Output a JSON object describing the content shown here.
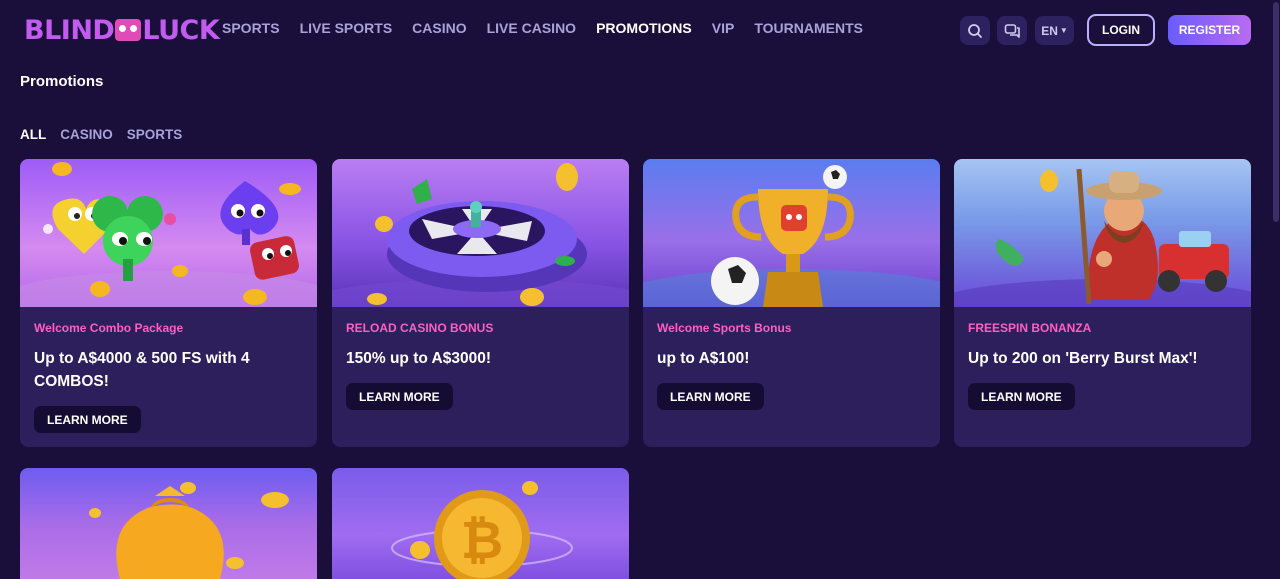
{
  "brand": {
    "logo_left": "BLIND",
    "logo_right": "LUCK"
  },
  "nav": [
    {
      "label": "SPORTS"
    },
    {
      "label": "LIVE SPORTS"
    },
    {
      "label": "CASINO"
    },
    {
      "label": "LIVE CASINO"
    },
    {
      "label": "PROMOTIONS",
      "active": true
    },
    {
      "label": "VIP"
    },
    {
      "label": "TOURNAMENTS"
    }
  ],
  "header": {
    "search_icon": "search-icon",
    "chat_icon": "chat-icon",
    "language": "EN",
    "login_label": "LOGIN",
    "register_label": "REGISTER"
  },
  "page": {
    "title": "Promotions"
  },
  "filters": [
    {
      "label": "ALL",
      "active": true
    },
    {
      "label": "CASINO"
    },
    {
      "label": "SPORTS"
    }
  ],
  "promos": [
    {
      "tag": "Welcome Combo Package",
      "title": "Up to A$4000 & 500 FS with 4 COMBOS!",
      "button": "LEARN MORE"
    },
    {
      "tag": "RELOAD CASINO BONUS",
      "title": "150% up to A$3000!",
      "button": "LEARN MORE"
    },
    {
      "tag": "Welcome Sports Bonus",
      "title": "up to A$100!",
      "button": "LEARN MORE"
    },
    {
      "tag": "FREESPIN BONANZA",
      "title": "Up to 200 on 'Berry Burst Max'!",
      "button": "LEARN MORE"
    }
  ],
  "colors": {
    "background": "#1a0f3a",
    "card": "#2c1f5c",
    "accent_tag": "#ff5fc1",
    "nav_inactive": "#a7a3d8"
  }
}
